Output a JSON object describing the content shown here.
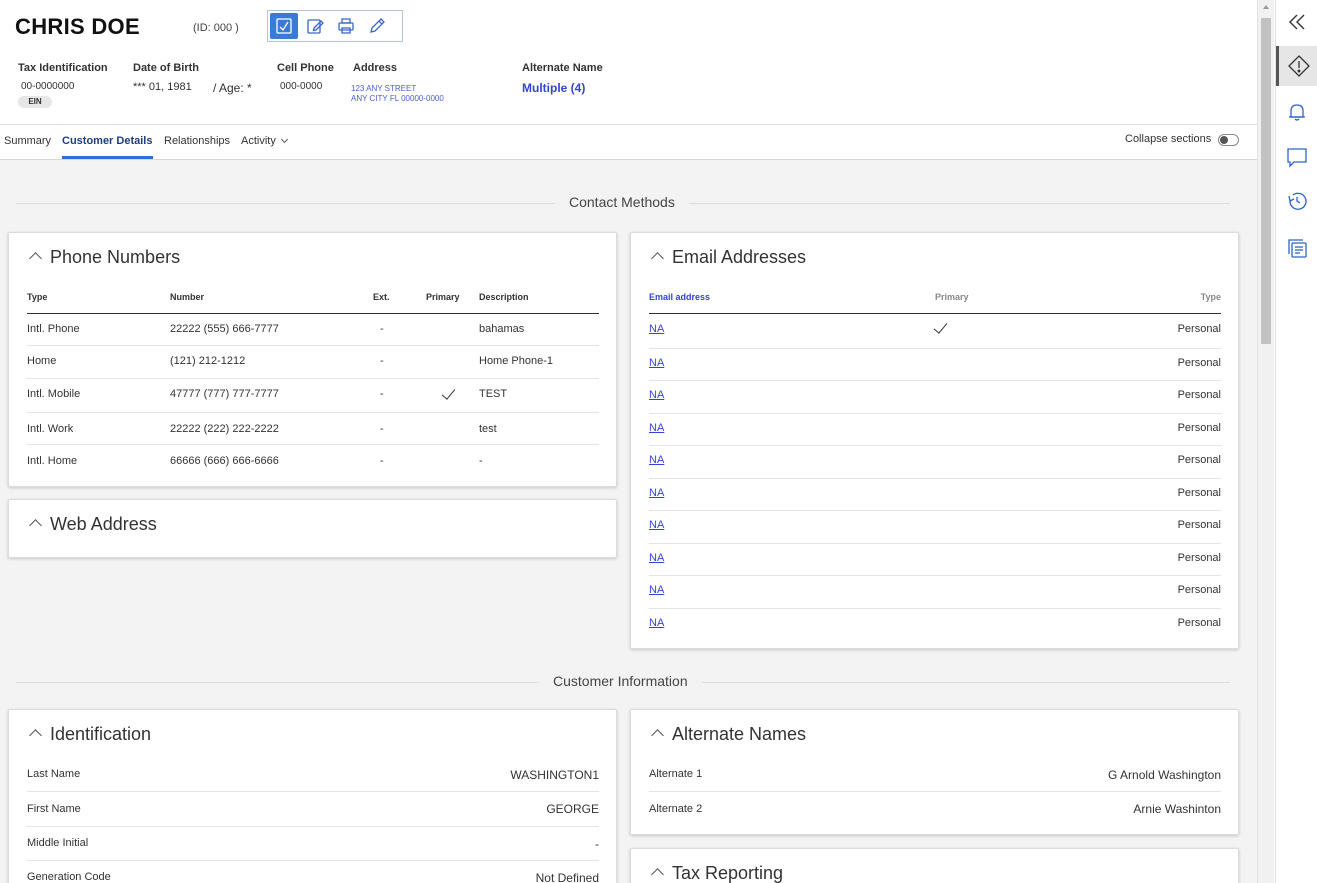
{
  "header": {
    "name": "CHRIS DOE",
    "id_text": "(ID: 000 )",
    "toolbar": [
      "checklist-icon",
      "edit-note-icon",
      "print-icon",
      "pencil-icon"
    ],
    "tax_id_label": "Tax Identification",
    "tax_id_value": "00-0000000",
    "tax_id_badge": "EIN",
    "dob_label": "Date of Birth",
    "dob_value": "*** 01, 1981",
    "age_text": "/ Age: *",
    "cell_label": "Cell Phone",
    "cell_value": "000-0000",
    "address_label": "Address",
    "address_line1": "123 ANY STREET",
    "address_line2": "ANY CITY FL 00000-0000",
    "alt_name_label": "Alternate Name",
    "alt_name_value": "Multiple (4)"
  },
  "tabs": {
    "summary": "Summary",
    "customer_details": "Customer Details",
    "relationships": "Relationships",
    "activity": "Activity",
    "active": "customer_details",
    "collapse_label": "Collapse sections",
    "collapse_on": false
  },
  "sections": {
    "contact_methods": "Contact Methods",
    "customer_information": "Customer Information"
  },
  "phone": {
    "title": "Phone Numbers",
    "headers": {
      "type": "Type",
      "number": "Number",
      "ext": "Ext.",
      "primary": "Primary",
      "description": "Description"
    },
    "rows": [
      {
        "type": "Intl. Phone",
        "number": "22222 (555) 666-7777",
        "ext": "-",
        "primary": false,
        "description": "bahamas"
      },
      {
        "type": "Home",
        "number": "(121) 212-1212",
        "ext": "-",
        "primary": false,
        "description": "Home Phone-1"
      },
      {
        "type": "Intl. Mobile",
        "number": "47777 (777) 777-7777",
        "ext": "-",
        "primary": true,
        "description": "TEST"
      },
      {
        "type": "Intl. Work",
        "number": "22222 (222) 222-2222",
        "ext": "-",
        "primary": false,
        "description": "test"
      },
      {
        "type": "Intl. Home",
        "number": "66666 (666) 666-6666",
        "ext": "-",
        "primary": false,
        "description": "-"
      }
    ]
  },
  "web": {
    "title": "Web Address"
  },
  "email": {
    "title": "Email Addresses",
    "headers": {
      "email": "Email address",
      "primary": "Primary",
      "type": "Type"
    },
    "rows": [
      {
        "email": "NA",
        "primary": true,
        "type": "Personal"
      },
      {
        "email": "NA",
        "primary": false,
        "type": "Personal"
      },
      {
        "email": "NA",
        "primary": false,
        "type": "Personal"
      },
      {
        "email": "NA",
        "primary": false,
        "type": "Personal"
      },
      {
        "email": "NA",
        "primary": false,
        "type": "Personal"
      },
      {
        "email": "NA",
        "primary": false,
        "type": "Personal"
      },
      {
        "email": "NA",
        "primary": false,
        "type": "Personal"
      },
      {
        "email": "NA",
        "primary": false,
        "type": "Personal"
      },
      {
        "email": "NA",
        "primary": false,
        "type": "Personal"
      },
      {
        "email": "NA",
        "primary": false,
        "type": "Personal"
      }
    ]
  },
  "identification": {
    "title": "Identification",
    "rows": [
      {
        "label": "Last Name",
        "value": "WASHINGTON1"
      },
      {
        "label": "First Name",
        "value": "GEORGE"
      },
      {
        "label": "Middle Initial",
        "value": "-"
      },
      {
        "label": "Generation Code",
        "value": "Not Defined"
      }
    ]
  },
  "alternate_names": {
    "title": "Alternate Names",
    "rows": [
      {
        "label": "Alternate 1",
        "value": "G Arnold Washington"
      },
      {
        "label": "Alternate 2",
        "value": "Arnie Washinton"
      }
    ]
  },
  "tax_reporting": {
    "title": "Tax Reporting"
  },
  "rail": [
    "collapse-panel-icon",
    "alert-icon",
    "bell-icon",
    "chat-icon",
    "history-icon",
    "documents-icon"
  ]
}
